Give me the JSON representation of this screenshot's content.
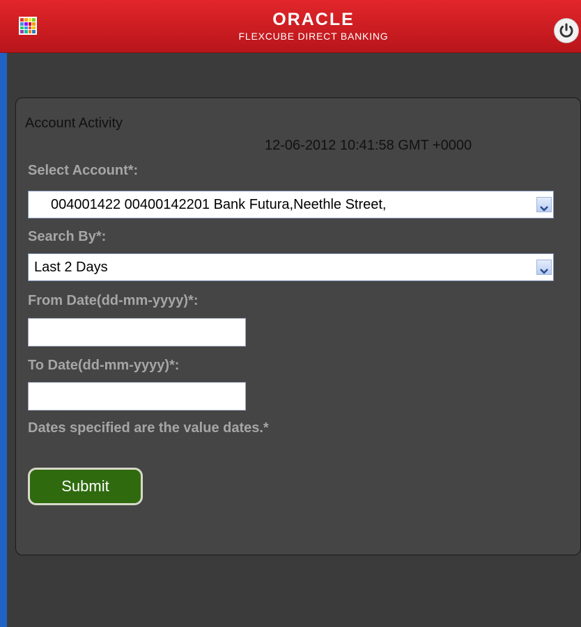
{
  "header": {
    "brand_logo": "ORACLE",
    "brand_subtitle": "FLEXCUBE DIRECT BANKING",
    "menu_icon": "app-grid-icon",
    "power_icon": "power-icon"
  },
  "page": {
    "title": "Account Activity",
    "timestamp": "12-06-2012 10:41:58 GMT +0000"
  },
  "form": {
    "select_account_label": "Select Account*:",
    "select_account_value": "004001422 00400142201 Bank Futura,Neethle Street,",
    "search_by_label": "Search By*:",
    "search_by_value": "Last 2 Days",
    "from_date_label": "From Date(dd-mm-yyyy)*:",
    "from_date_value": "",
    "to_date_label": "To Date(dd-mm-yyyy)*:",
    "to_date_value": "",
    "note": "Dates specified are the value dates.*",
    "submit_label": "Submit"
  },
  "colors": {
    "header_red": "#d41f24",
    "background": "#3b3b3b",
    "submit_green": "#2f6a0f",
    "label_gray": "#a6a6a6"
  }
}
